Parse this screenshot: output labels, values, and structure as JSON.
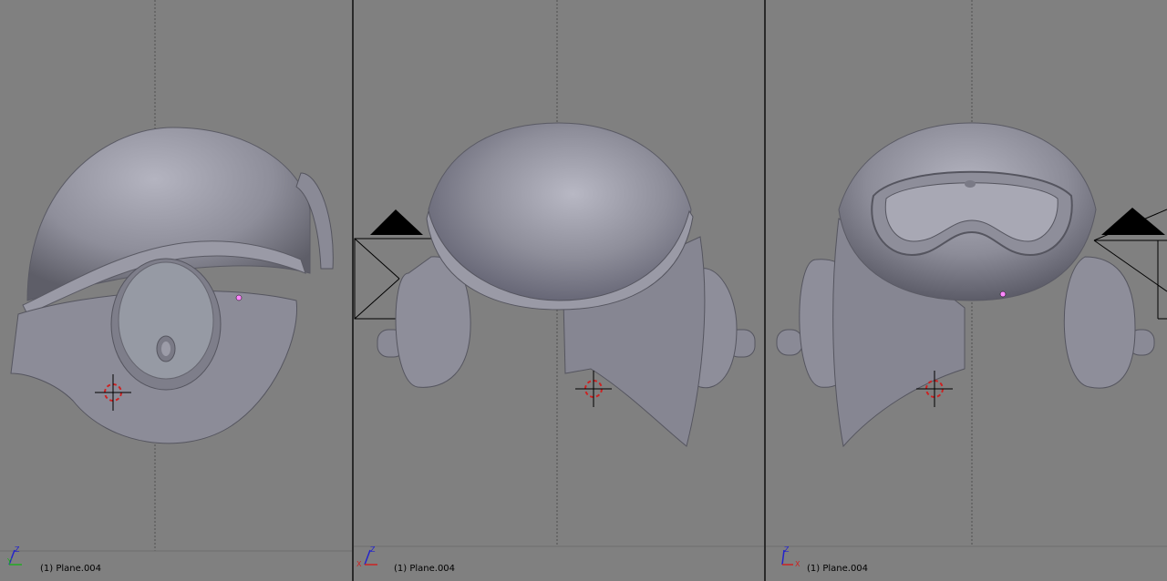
{
  "viewports": [
    {
      "name": "side-view",
      "label": "(1) Plane.004",
      "axis_labels": [
        "Z",
        "Y"
      ],
      "axis_colors": [
        "#2222cc",
        "#22aa22"
      ]
    },
    {
      "name": "front-view",
      "label": "(1) Plane.004",
      "axis_labels": [
        "Z",
        "X"
      ],
      "axis_colors": [
        "#2222cc",
        "#cc2222"
      ]
    },
    {
      "name": "front-perspective-view",
      "label": "(1) Plane.004",
      "axis_labels": [
        "Z",
        "X"
      ],
      "axis_colors": [
        "#2222cc",
        "#cc2222"
      ]
    }
  ],
  "colors": {
    "viewport_bg": "#808080",
    "model": "#8a8a96",
    "grid": "#505050",
    "cursor": "#cc2222",
    "selected_vertex": "#ff88ff"
  }
}
